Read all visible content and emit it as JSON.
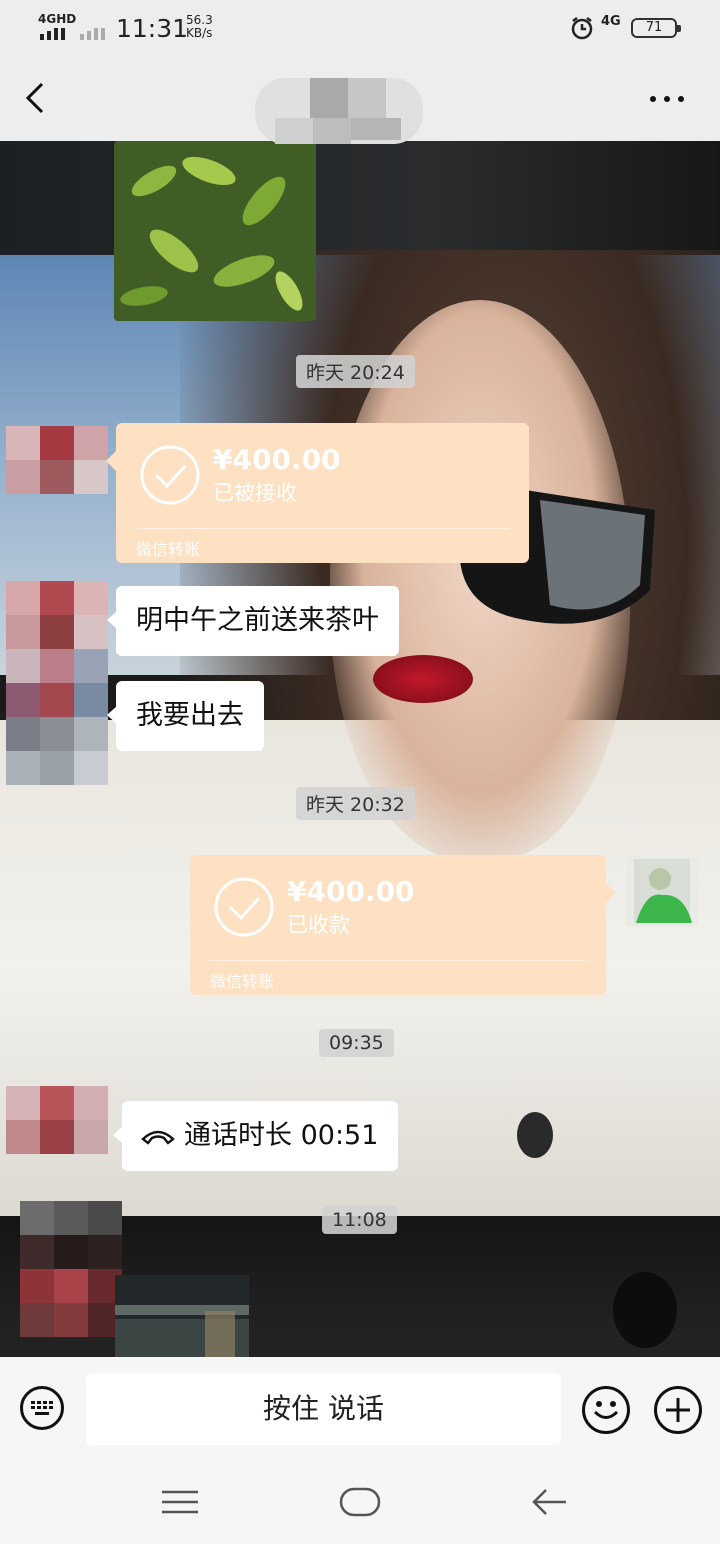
{
  "status_bar": {
    "network": "4GHD",
    "time": "11:31",
    "speed_value": "56.3",
    "speed_unit": "KB/s",
    "network_right": "4G",
    "battery": "71"
  },
  "header": {
    "back_icon": "chevron-left-icon",
    "more_icon": "more-dots-icon"
  },
  "messages": {
    "ts1": "昨天 20:24",
    "transfer1": {
      "amount": "¥400.00",
      "status": "已被接收",
      "label": "微信转账"
    },
    "text1": "明中午之前送来茶叶",
    "text2": "我要出去",
    "ts2": "昨天 20:32",
    "transfer2": {
      "amount": "¥400.00",
      "status": "已收款",
      "label": "微信转账"
    },
    "ts3": "09:35",
    "call": {
      "icon": "phone-hangup-icon",
      "text": "通话时长 00:51"
    },
    "ts4": "11:08"
  },
  "input_bar": {
    "keyboard_icon": "keyboard-icon",
    "hold_to_talk": "按住 说话",
    "emoji_icon": "emoji-icon",
    "plus_icon": "plus-icon"
  },
  "colors": {
    "transfer_bg": "#fde1c2",
    "bar_bg": "#ededed"
  }
}
